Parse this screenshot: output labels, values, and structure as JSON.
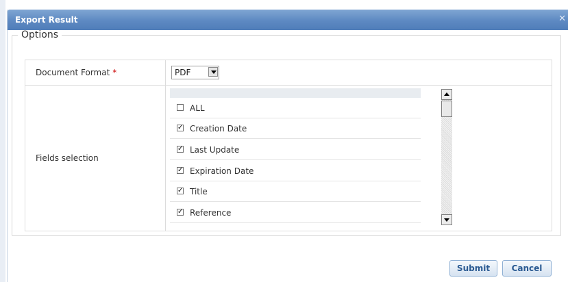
{
  "dialog": {
    "title": "Export Result",
    "close_icon": "close-icon"
  },
  "options": {
    "legend": "Options",
    "document_format": {
      "label": "Document Format",
      "required_mark": "*",
      "selected": "PDF"
    },
    "fields_selection": {
      "label": "Fields selection",
      "items": [
        {
          "label": "ALL",
          "checked": false
        },
        {
          "label": "Creation Date",
          "checked": true
        },
        {
          "label": "Last Update",
          "checked": true
        },
        {
          "label": "Expiration Date",
          "checked": true
        },
        {
          "label": "Title",
          "checked": true
        },
        {
          "label": "Reference",
          "checked": true
        }
      ]
    }
  },
  "buttons": {
    "submit": "Submit",
    "cancel": "Cancel"
  }
}
